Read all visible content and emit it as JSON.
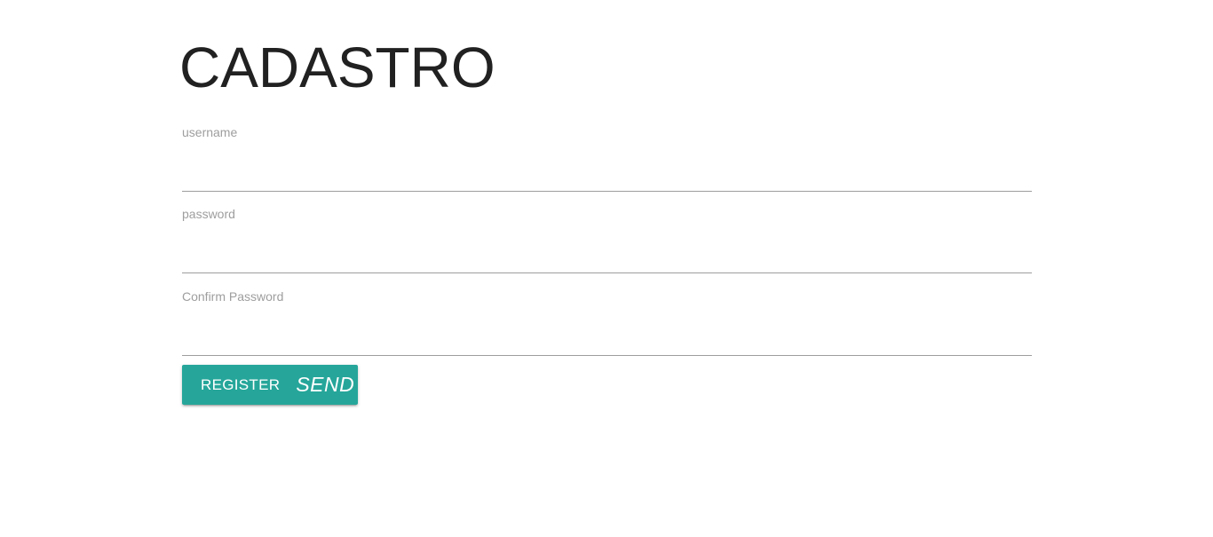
{
  "page": {
    "title": "CADASTRO"
  },
  "form": {
    "fields": [
      {
        "label": "username",
        "value": ""
      },
      {
        "label": "password",
        "value": ""
      },
      {
        "label": "Confirm Password",
        "value": ""
      }
    ],
    "submit": {
      "label": "REGISTER",
      "icon_text": "SEND",
      "icon": "send-icon",
      "color": "#26a69a"
    }
  }
}
